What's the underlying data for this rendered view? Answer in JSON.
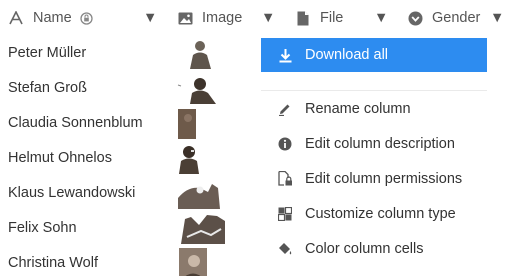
{
  "columns": [
    {
      "label": "Name",
      "icon": "text-icon"
    },
    {
      "label": "Image",
      "icon": "image-icon"
    },
    {
      "label": "File",
      "icon": "file-icon"
    },
    {
      "label": "Gender",
      "icon": "single-select-icon"
    }
  ],
  "rows": [
    {
      "name": "Peter Müller"
    },
    {
      "name": "Stefan Groß"
    },
    {
      "name": "Claudia Sonnenblum"
    },
    {
      "name": "Helmut Ohnelos"
    },
    {
      "name": "Klaus Lewandowski"
    },
    {
      "name": "Felix Sohn"
    },
    {
      "name": "Christina Wolf"
    }
  ],
  "menu": {
    "download_all": "Download all",
    "rename": "Rename column",
    "edit_description": "Edit column description",
    "edit_permissions": "Edit column permissions",
    "customize_type": "Customize column type",
    "color_cells": "Color column cells"
  },
  "colors": {
    "accent": "#2d8cf0",
    "text": "#333333",
    "icon": "#555555"
  }
}
